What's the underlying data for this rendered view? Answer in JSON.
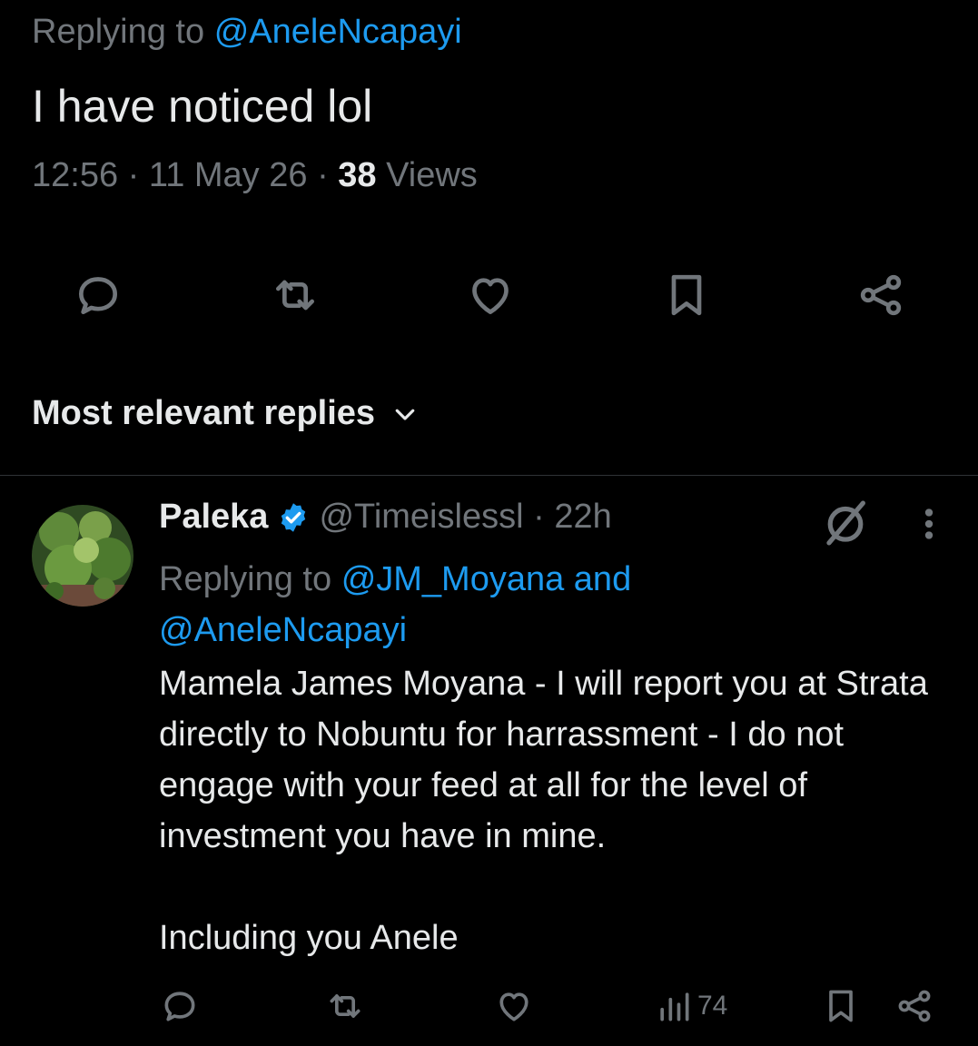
{
  "main_tweet": {
    "replying_prefix": "Replying to",
    "replying_handle": "@AneleNcapayi",
    "text": "I have noticed lol",
    "time": "12:56",
    "date": "11 May 26",
    "views_count": "38",
    "views_label": "Views"
  },
  "actions": [
    "reply-icon",
    "retweet-icon",
    "like-icon",
    "bookmark-icon",
    "share-icon"
  ],
  "replies_sort": {
    "label": "Most relevant replies"
  },
  "reply": {
    "name": "Paleka",
    "handle": "@Timeislessl",
    "time": "22h",
    "replying_prefix": "Replying to",
    "replying_handles": "@JM_Moyana and",
    "replying_handles_2": "@AneleNcapayi",
    "body": "Mamela James Moyana - I will report you at Strata directly to Nobuntu for harrassment - I do not engage with your feed at all for the level of investment you have in mine.\n\nIncluding you Anele",
    "views": "74"
  },
  "colors": {
    "background": "#000000",
    "text": "#e7e9ea",
    "muted": "#71767b",
    "accent": "#1d9bf0"
  }
}
